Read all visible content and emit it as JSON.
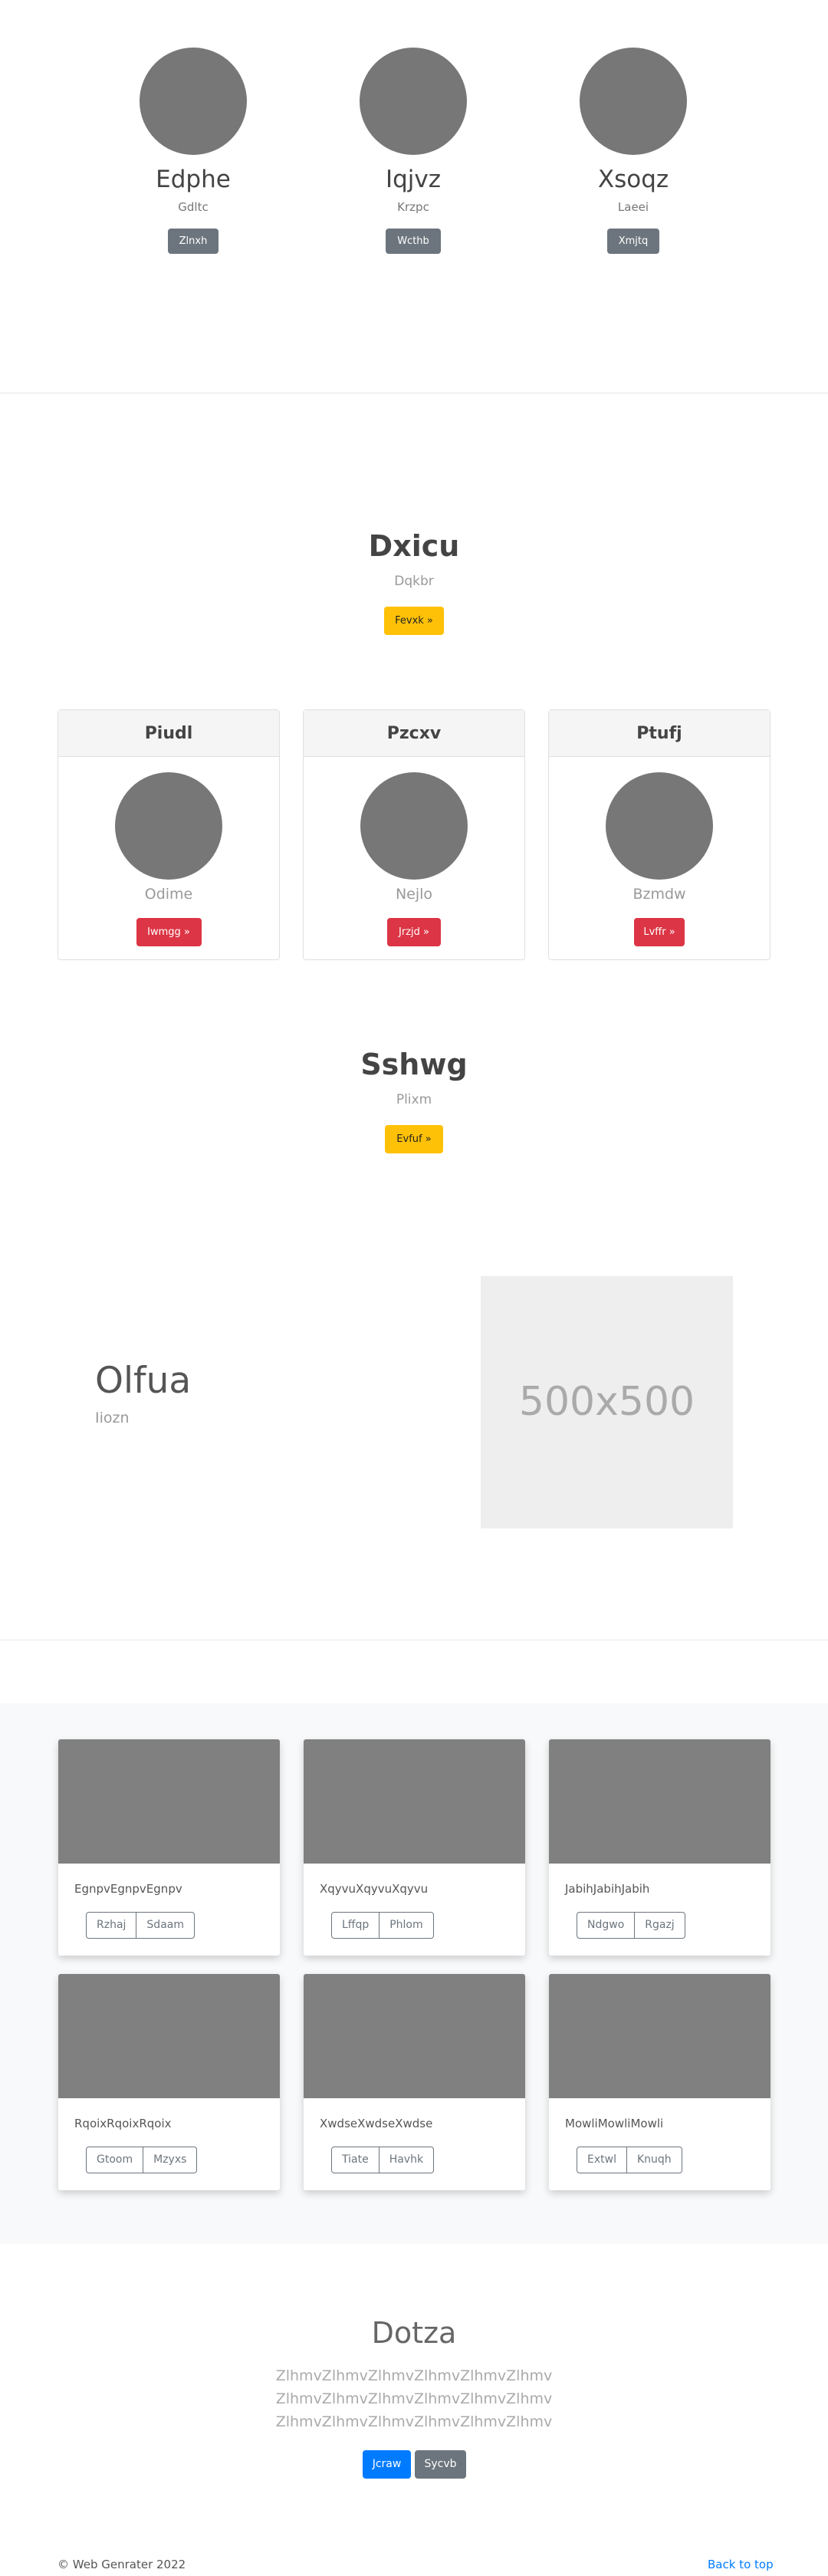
{
  "team": [
    {
      "name": "Edphe",
      "role": "Gdltc",
      "button": "Zlnxh"
    },
    {
      "name": "Iqjvz",
      "role": "Krzpc",
      "button": "Wcthb"
    },
    {
      "name": "Xsoqz",
      "role": "Laeei",
      "button": "Xmjtq"
    }
  ],
  "hero1": {
    "title": "Dxicu",
    "subtitle": "Dqkbr",
    "button": "Fevxk »"
  },
  "cards": [
    {
      "header": "Piudl",
      "subtitle": "Odime",
      "button": "Iwmgg »"
    },
    {
      "header": "Pzcxv",
      "subtitle": "Nejlo",
      "button": "Jrzjd »"
    },
    {
      "header": "Ptufj",
      "subtitle": "Bzmdw",
      "button": "Lvffr »"
    }
  ],
  "hero2": {
    "title": "Sshwg",
    "subtitle": "Plixm",
    "button": "Evfuf »"
  },
  "feature": {
    "title": "Olfua",
    "subtitle": "Iiozn",
    "image_label": "500x500"
  },
  "album": [
    {
      "text": "EgnpvEgnpvEgnpv",
      "btn1": "Rzhaj",
      "btn2": "Sdaam"
    },
    {
      "text": "XqyvuXqyvuXqyvu",
      "btn1": "Lffqp",
      "btn2": "Phlom"
    },
    {
      "text": "JabihJabihJabih",
      "btn1": "Ndgwo",
      "btn2": "Rgazj"
    },
    {
      "text": "RqoixRqoixRqoix",
      "btn1": "Gtoom",
      "btn2": "Mzyxs"
    },
    {
      "text": "XwdseXwdseXwdse",
      "btn1": "Tiate",
      "btn2": "Havhk"
    },
    {
      "text": "MowliMowliMowli",
      "btn1": "Extwl",
      "btn2": "Knuqh"
    }
  ],
  "closing": {
    "title": "Dotza",
    "lines": [
      "ZlhmvZlhmvZlhmvZlhmvZlhmvZlhmv",
      "ZlhmvZlhmvZlhmvZlhmvZlhmvZlhmv",
      "ZlhmvZlhmvZlhmvZlhmvZlhmvZlhmv"
    ],
    "primary_button": "Jcraw",
    "secondary_button": "Sycvb"
  },
  "footer": {
    "copyright": "© Web Genrater 2022",
    "back_to_top": "Back to top"
  }
}
